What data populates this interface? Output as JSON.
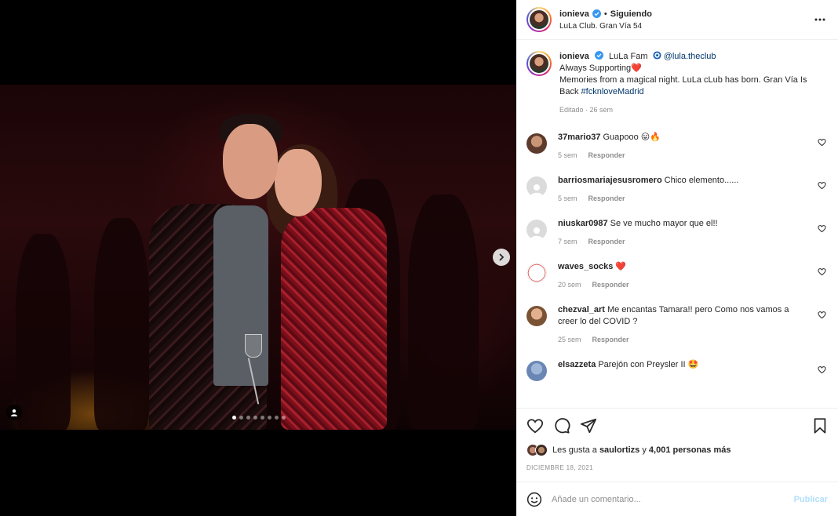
{
  "header": {
    "username": "ionieva",
    "separator": "•",
    "follow_status": "Siguiendo",
    "location": "LuLa Club. Gran Vía 54"
  },
  "caption": {
    "username": "ionieva",
    "line1_text": "LuLa Fam",
    "mention": "@lula.theclub",
    "line2_text": "Always Supporting",
    "line3_text": "Memories from a magical night. LuLa cLub has born. Gran Vía Is Back",
    "hashtag": "#fcknloveMadrid",
    "meta": "Editado · 26 sem",
    "heart": "❤️"
  },
  "comments": [
    {
      "username": "37mario37",
      "text": "Guapooo 😛🔥",
      "time": "5 sem",
      "reply": "Responder",
      "avatar": "photo"
    },
    {
      "username": "barriosmariajesusromero",
      "text": "Chico elemento......",
      "time": "5 sem",
      "reply": "Responder",
      "avatar": "placeholder"
    },
    {
      "username": "niuskar0987",
      "text": "Se ve mucho mayor que el!!",
      "time": "7 sem",
      "reply": "Responder",
      "avatar": "placeholder"
    },
    {
      "username": "waves_socks",
      "text": "❤️",
      "time": "20 sem",
      "reply": "Responder",
      "avatar": "logo"
    },
    {
      "username": "chezval_art",
      "text": "Me encantas Tamara!! pero Como nos vamos a creer lo del COVID ?",
      "time": "25 sem",
      "reply": "Responder",
      "avatar": "photo"
    },
    {
      "username": "elsazzeta",
      "text": "Parejón con Preysler II 🤩",
      "time": "",
      "reply": "",
      "avatar": "photo"
    }
  ],
  "likes": {
    "prefix": "Les gusta a",
    "user": "saulortizs",
    "connector": "y",
    "count_text": "4,001 personas más"
  },
  "date": "DICIEMBRE 18, 2021",
  "add_comment": {
    "placeholder": "Añade un comentario...",
    "publish_label": "Publicar"
  },
  "carousel": {
    "total_slides": 8,
    "active_index": 0
  },
  "colors": {
    "link": "#00376b",
    "muted": "#8e8e8e",
    "verified": "#3897f0",
    "publish_disabled": "#b2dffc"
  }
}
